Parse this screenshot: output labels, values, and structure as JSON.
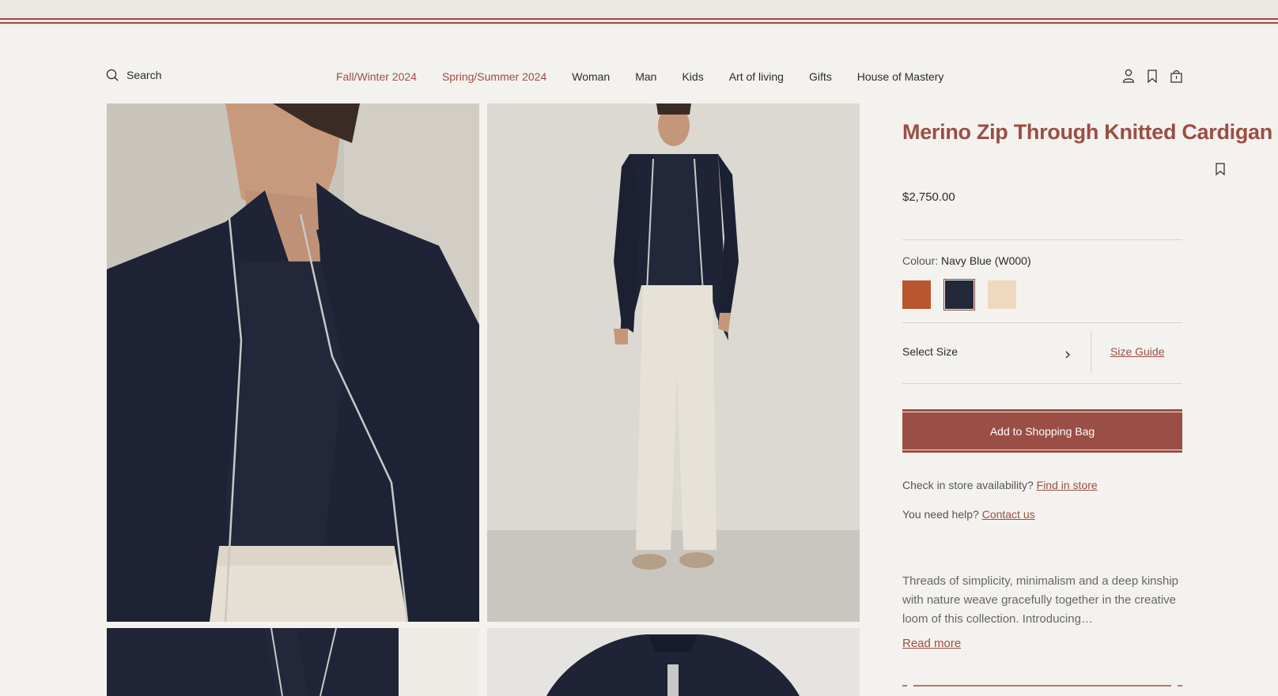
{
  "header": {
    "search_label": "Search",
    "nav": [
      {
        "label": "Fall/Winter 2024",
        "accent": true
      },
      {
        "label": "Spring/Summer 2024",
        "accent": true
      },
      {
        "label": "Woman",
        "accent": false
      },
      {
        "label": "Man",
        "accent": false
      },
      {
        "label": "Kids",
        "accent": false
      },
      {
        "label": "Art of living",
        "accent": false
      },
      {
        "label": "Gifts",
        "accent": false
      },
      {
        "label": "House of Mastery",
        "accent": false
      }
    ],
    "icons": [
      "account-icon",
      "wishlist-icon",
      "shopping-bag-icon"
    ]
  },
  "product": {
    "title": "Merino Zip Through Knitted Cardigan",
    "price": "$2,750.00",
    "colour_label": "Colour:",
    "colour_value": "Navy Blue (W000)",
    "swatches": [
      {
        "name": "rust",
        "color": "#b9562f",
        "selected": false
      },
      {
        "name": "navy",
        "color": "#232838",
        "selected": true
      },
      {
        "name": "cream",
        "color": "#efd9be",
        "selected": false
      }
    ],
    "select_size": "Select Size",
    "size_guide": "Size Guide",
    "add_to_bag": "Add to Shopping Bag",
    "store_prompt": "Check in store availability?",
    "store_link": "Find in store",
    "help_prompt": "You need help?",
    "help_link": "Contact us",
    "description": "Threads of simplicity, minimalism and a deep kinship with nature weave gracefully together in the creative loom of this collection. Introducing…",
    "read_more": "Read more"
  },
  "colors": {
    "accent": "#9b4e45",
    "background": "#f4f2ee"
  }
}
